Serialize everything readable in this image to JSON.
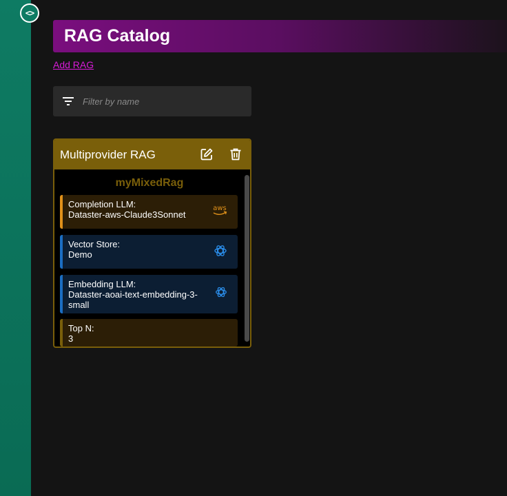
{
  "sidebar": {
    "toggle_label": "<>"
  },
  "page": {
    "title": "RAG Catalog",
    "add_link": "Add RAG"
  },
  "filter": {
    "placeholder": "Filter by name",
    "value": ""
  },
  "cards": [
    {
      "title": "Multiprovider RAG",
      "rag_name": "myMixedRag",
      "items": [
        {
          "label": "Completion LLM:",
          "value": "Dataster-aws-Claude3Sonnet",
          "icon": "aws-icon",
          "accent": "#e0911a"
        },
        {
          "label": "Vector Store:",
          "value": "Demo",
          "icon": "openai-icon",
          "accent": "#1b6ec2"
        },
        {
          "label": "Embedding LLM:",
          "value": "Dataster-aoai-text-embedding-3-small",
          "icon": "openai-icon",
          "accent": "#1b6ec2"
        },
        {
          "label": "Top N:",
          "value": "3",
          "accent": "#7a5f0a"
        }
      ]
    }
  ],
  "colors": {
    "sidebar": "#0e7b63",
    "title_start": "#7a0e7e",
    "card_accent": "#7a5f0a",
    "link": "#d81bd8"
  }
}
